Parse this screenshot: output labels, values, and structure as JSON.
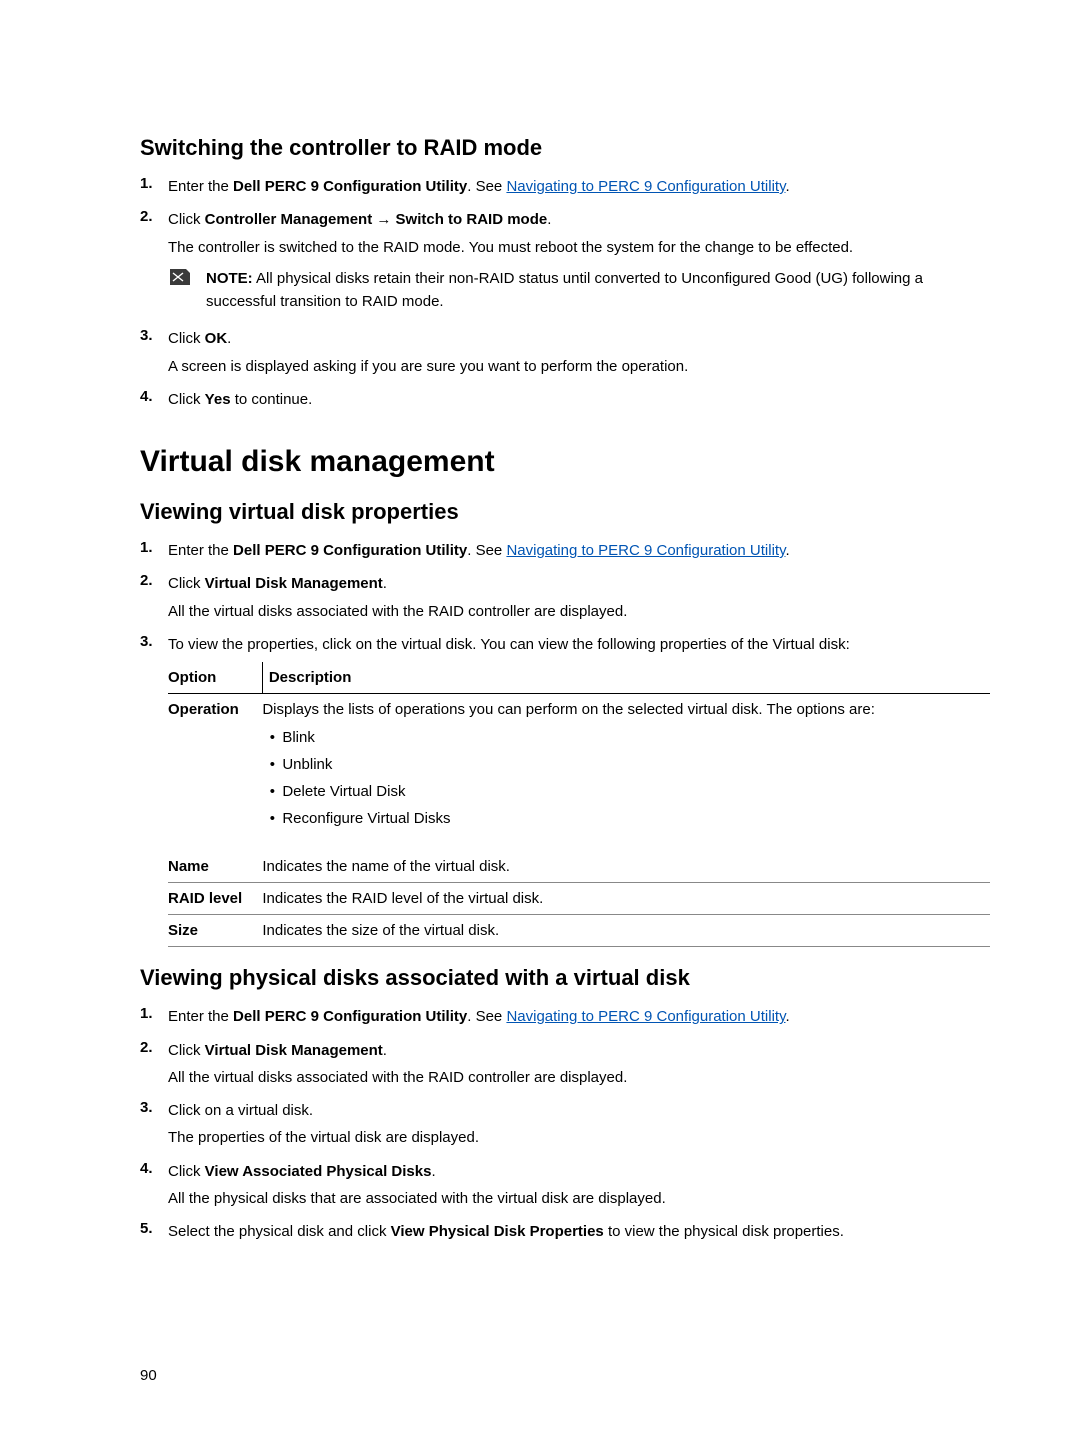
{
  "section1": {
    "heading": "Switching the controller to RAID mode",
    "steps": [
      {
        "num": "1.",
        "parts": [
          "Enter the ",
          "Dell PERC 9 Configuration Utility",
          ". See "
        ],
        "link": "Navigating to PERC 9 Configuration Utility",
        "tail": "."
      },
      {
        "num": "2.",
        "parts": [
          "Click ",
          "Controller Management",
          " → ",
          "Switch to RAID mode",
          "."
        ],
        "para": "The controller is switched to the RAID mode. You must reboot the system for the change to be effected.",
        "note_label": "NOTE:",
        "note_text": " All physical disks retain their non-RAID status until converted to Unconfigured Good (UG) following a successful transition to RAID mode."
      },
      {
        "num": "3.",
        "parts": [
          "Click ",
          "OK",
          "."
        ],
        "para": "A screen is displayed asking if you are sure you want to perform the operation."
      },
      {
        "num": "4.",
        "parts": [
          "Click ",
          "Yes",
          " to continue."
        ]
      }
    ]
  },
  "h2": "Virtual disk management",
  "section2": {
    "heading": "Viewing virtual disk properties",
    "steps": [
      {
        "num": "1.",
        "parts": [
          "Enter the ",
          "Dell PERC 9 Configuration Utility",
          ". See "
        ],
        "link": "Navigating to PERC 9 Configuration Utility",
        "tail": "."
      },
      {
        "num": "2.",
        "parts": [
          "Click ",
          "Virtual Disk Management",
          "."
        ],
        "para": "All the virtual disks associated with the RAID controller are displayed."
      },
      {
        "num": "3.",
        "text": "To view the properties, click on the virtual disk. You can view the following properties of the Virtual disk:"
      }
    ],
    "table": {
      "head": [
        "Option",
        "Description"
      ],
      "rows": [
        {
          "opt": "Operation",
          "desc_intro": "Displays the lists of operations you can perform on the selected virtual disk. The options are:",
          "bullets": [
            "Blink",
            "Unblink",
            "Delete Virtual Disk",
            "Reconfigure Virtual Disks"
          ]
        },
        {
          "opt": "Name",
          "desc": "Indicates the name of the virtual disk."
        },
        {
          "opt": "RAID level",
          "desc": "Indicates the RAID level of the virtual disk."
        },
        {
          "opt": "Size",
          "desc": "Indicates the size of the virtual disk."
        }
      ]
    }
  },
  "section3": {
    "heading": "Viewing physical disks associated with a virtual disk",
    "steps": [
      {
        "num": "1.",
        "parts": [
          "Enter the ",
          "Dell PERC 9 Configuration Utility",
          ". See "
        ],
        "link": "Navigating to PERC 9 Configuration Utility",
        "tail": "."
      },
      {
        "num": "2.",
        "parts": [
          "Click ",
          "Virtual Disk Management",
          "."
        ],
        "para": "All the virtual disks associated with the RAID controller are displayed."
      },
      {
        "num": "3.",
        "text": "Click on a virtual disk.",
        "para": "The properties of the virtual disk are displayed."
      },
      {
        "num": "4.",
        "parts": [
          "Click ",
          "View Associated Physical Disks",
          "."
        ],
        "para": "All the physical disks that are associated with the virtual disk are displayed."
      },
      {
        "num": "5.",
        "parts": [
          "Select the physical disk and click ",
          "View Physical Disk Properties",
          " to view the physical disk properties."
        ]
      }
    ]
  },
  "pageno": "90"
}
